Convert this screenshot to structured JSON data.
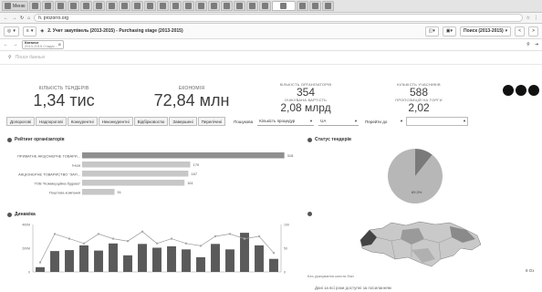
{
  "browser": {
    "tabs": [
      "Меню",
      "",
      "",
      "",
      "",
      "",
      "",
      "",
      "",
      "",
      "",
      "",
      "",
      "",
      "",
      "",
      "",
      "",
      "",
      "",
      "",
      "",
      "",
      ""
    ],
    "url": "h. prozorro.org",
    "window_title": "2. Учет закупівель (2013-2015) - Purchasing stage (2013-2015)"
  },
  "toolbar": {
    "menu_label": "≡",
    "sheet_nav": "Каталог",
    "sheet_nav_sub": "2013-2015 Стадія...",
    "right_dropdown": "Поиск (2013-2015)"
  },
  "search": {
    "placeholder": "Поиск данных"
  },
  "kpis": {
    "tenders_label": "КІЛЬКІСТЬ ТЕНДЕРІВ",
    "tenders_value": "1,34 тис",
    "savings_label": "ЕКОНОМІЯ",
    "savings_value": "72,84 млн",
    "orgs_label": "КІЛЬКІСТЬ ОРГАНІЗАТОРІВ",
    "orgs_value": "354",
    "expected_label": "ОЧІКУВАНА ВАРТІСТЬ",
    "expected_value": "2,08 млрд",
    "participants_label": "КІЛЬКІСТЬ УЧАСНИКІВ",
    "participants_value": "588",
    "offers_label": "ПРОПОЗИЦІЙ НА ТОРГИ",
    "offers_value": "2,02"
  },
  "filters": {
    "buttons": [
      "Допорогові",
      "Надпорогові",
      "Конкурентні",
      "Неконкурентні",
      "Відбірковостю",
      "Завершені",
      "Перелічені"
    ],
    "search_label": "Пошукова",
    "dropdown1": "Кількість процедур",
    "dropdown2": "UA",
    "dropdown3": "Перейти до"
  },
  "panels": {
    "rating_title": "Рейтинг організаторів",
    "status_title": "Статус тендерів",
    "dynamics_title": "Динаміка",
    "map_title": "",
    "map_note": "Без урахування консти бізн",
    "map_footer": "Дані за всі роки доступні за посиланням",
    "map_value": "8 Оз"
  },
  "rating": {
    "items": [
      {
        "label": "ПРИВАТНЕ АКЦІОНЕРНЕ ТОВАРИ...",
        "value": 318,
        "text": "318"
      },
      {
        "label": "Інша",
        "value": 170,
        "text": "170"
      },
      {
        "label": "АКЦІОНЕРНЕ ТОВАРИСТВО \"ЗАП...",
        "value": 167,
        "text": "167"
      },
      {
        "label": "ТОВ \"Коммерційна будова\"",
        "value": 161,
        "text": "161"
      },
      {
        "label": "Поштова компанія",
        "value": 51,
        "text": "51"
      }
    ]
  },
  "chart_data": [
    {
      "type": "bar",
      "title": "Рейтинг організаторів",
      "categories": [
        "ПРИВАТНЕ АКЦІОНЕРНЕ ТОВАРИ...",
        "Інша",
        "АКЦІОНЕРНЕ ТОВАРИСТВО \"ЗАП...",
        "ТОВ \"Коммерційна будова\"",
        "Поштова компанія"
      ],
      "values": [
        318,
        170,
        167,
        161,
        51
      ]
    },
    {
      "type": "pie",
      "title": "Статус тендерів",
      "labels": [
        "",
        ""
      ],
      "values": [
        89.3,
        10.7
      ],
      "data_label": "89,3%"
    },
    {
      "type": "bar",
      "title": "Динаміка",
      "categories": [
        "",
        "",
        "",
        "",
        "",
        "",
        "",
        "",
        "",
        "",
        "",
        "",
        "",
        "",
        "",
        "",
        ""
      ],
      "values": [
        20,
        88,
        92,
        112,
        90,
        120,
        70,
        118,
        102,
        108,
        95,
        62,
        118,
        95,
        165,
        112,
        55
      ],
      "line": [
        4,
        16,
        14,
        12,
        16,
        14,
        13,
        17,
        12,
        14,
        12,
        11,
        15,
        16,
        14,
        15,
        8
      ],
      "ylabel": "",
      "y2label": "",
      "ylim": [
        0,
        200
      ],
      "yticks": [
        "400М",
        "200М",
        "0"
      ],
      "y2ticks": [
        "100",
        "50",
        "0"
      ]
    }
  ]
}
